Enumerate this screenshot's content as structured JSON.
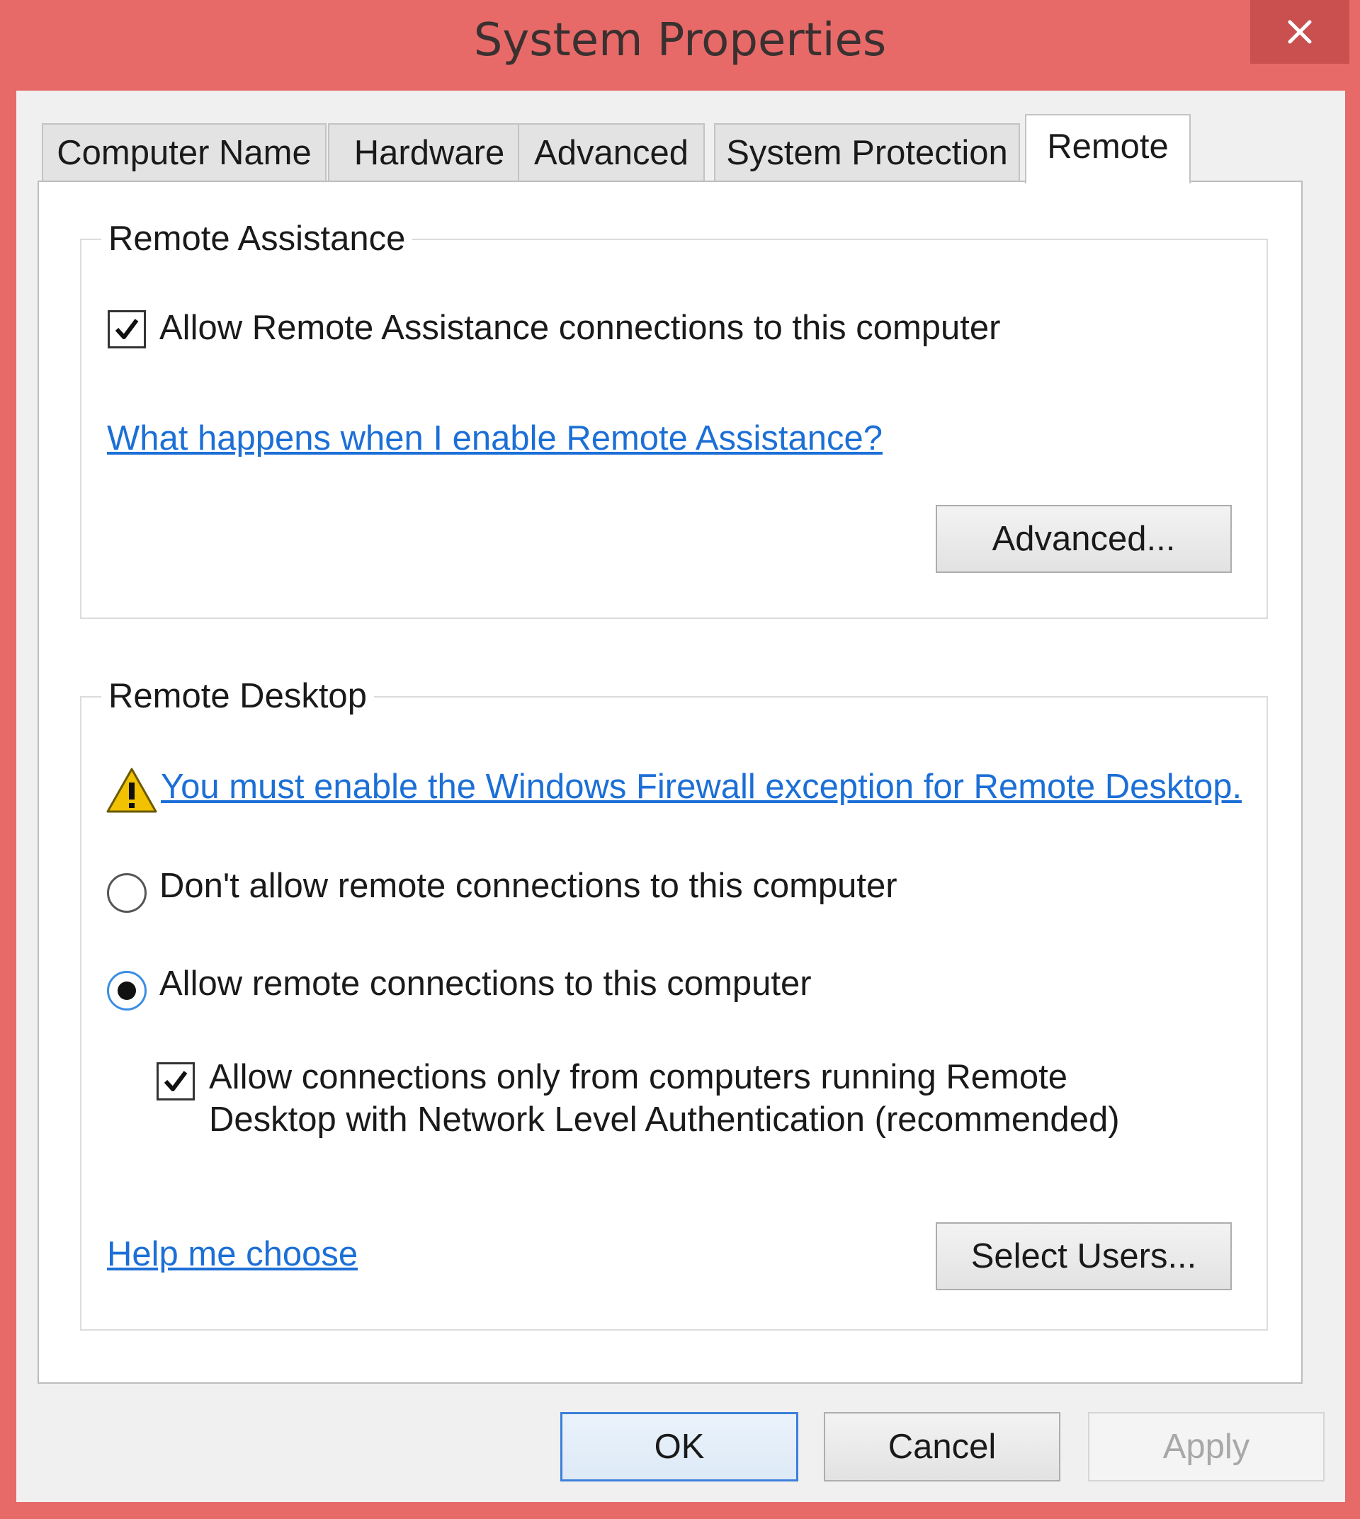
{
  "window": {
    "title": "System Properties"
  },
  "tabs": [
    {
      "label": "Computer Name"
    },
    {
      "label": "Hardware"
    },
    {
      "label": "Advanced"
    },
    {
      "label": "System Protection"
    },
    {
      "label": "Remote",
      "active": true
    }
  ],
  "remote_assistance": {
    "group_label": "Remote Assistance",
    "allow_checkbox": {
      "label": "Allow Remote Assistance connections to this computer",
      "checked": true
    },
    "help_link": "What happens when I enable Remote Assistance?",
    "advanced_button": "Advanced..."
  },
  "remote_desktop": {
    "group_label": "Remote Desktop",
    "firewall_warning_link": "You must enable the Windows Firewall exception for Remote Desktop.",
    "warning_icon": "warning-icon",
    "option_dont_allow": {
      "label": "Don't allow remote connections to this computer",
      "selected": false
    },
    "option_allow": {
      "label": "Allow remote connections to this computer",
      "selected": true
    },
    "nla_checkbox": {
      "line1": "Allow connections only from computers running Remote",
      "line2": "Desktop with Network Level Authentication (recommended)",
      "checked": true
    },
    "help_link": "Help me choose",
    "select_users_button": "Select Users..."
  },
  "footer": {
    "ok": "OK",
    "cancel": "Cancel",
    "apply": "Apply"
  },
  "colors": {
    "frame": "#e76a69",
    "link": "#1c6fd6",
    "warning": "#f2c200"
  }
}
